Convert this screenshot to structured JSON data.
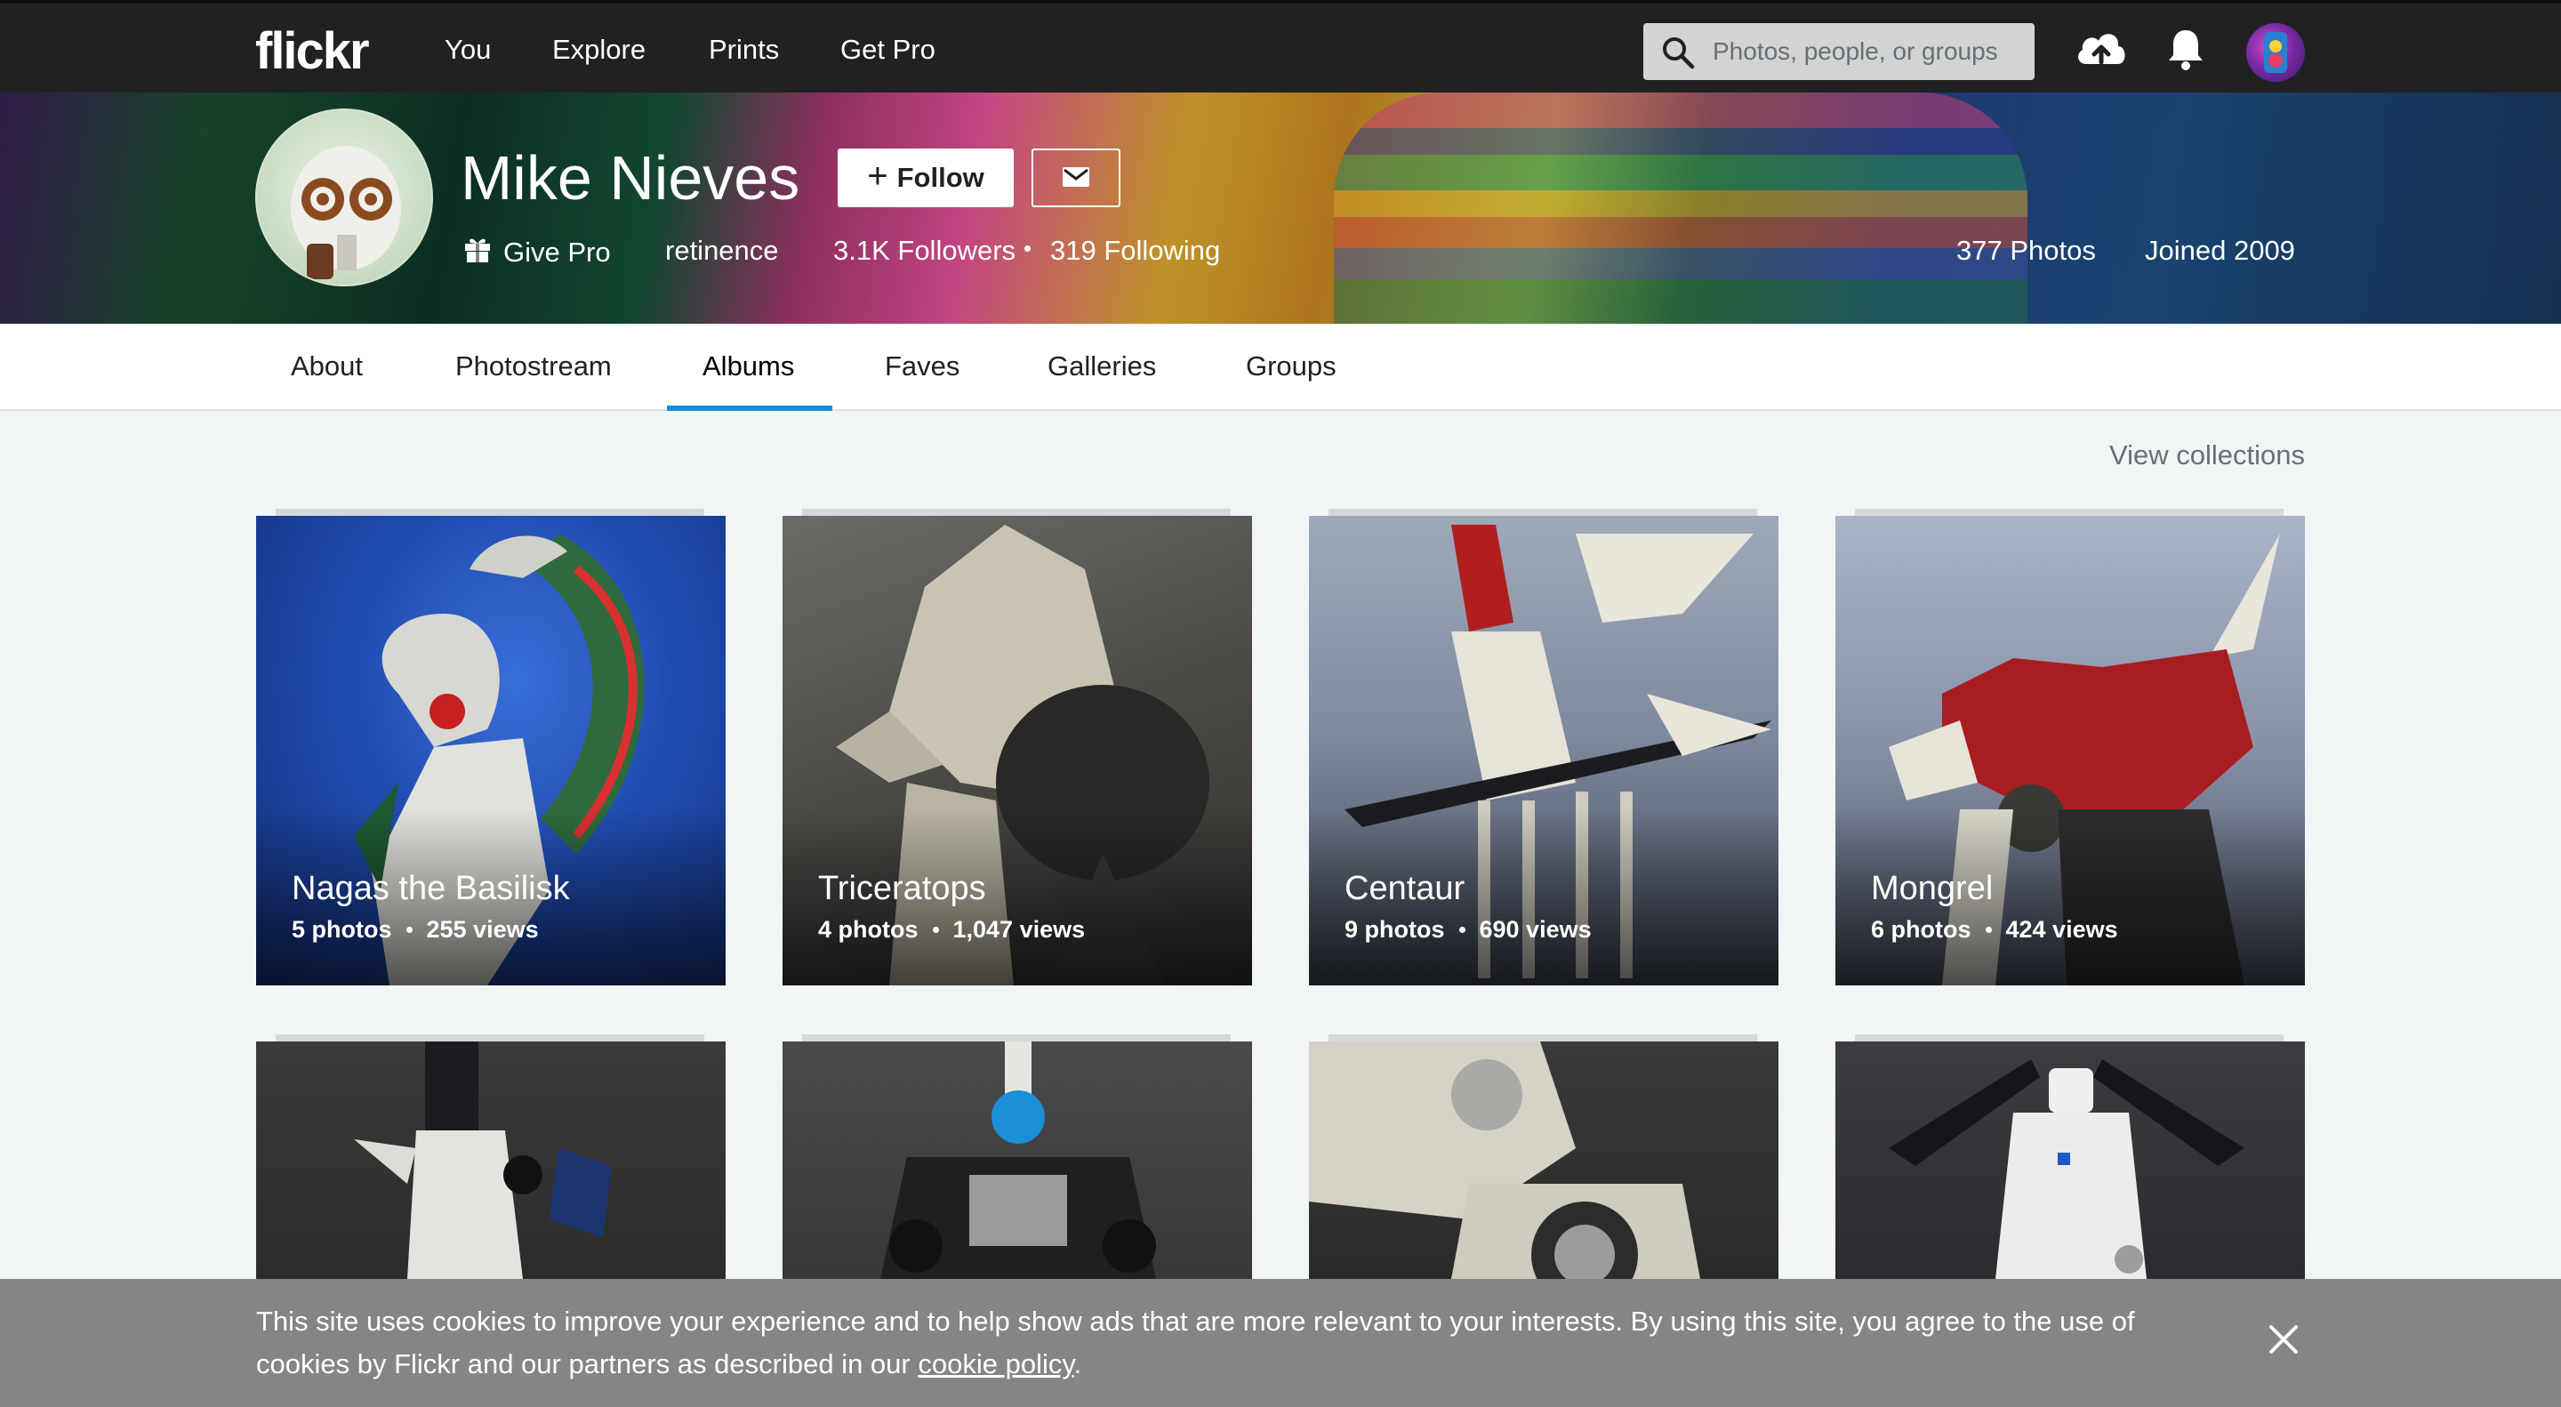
{
  "topnav": {
    "logo": "flickr",
    "links": [
      "You",
      "Explore",
      "Prints",
      "Get Pro"
    ],
    "search_placeholder": "Photos, people, or groups"
  },
  "profile": {
    "name": "Mike Nieves",
    "follow_label": "Follow",
    "give_pro_label": "Give Pro",
    "username": "retinence",
    "followers": "3.1K Followers",
    "following": "319 Following",
    "photos": "377 Photos",
    "joined": "Joined 2009"
  },
  "subnav": {
    "tabs": [
      "About",
      "Photostream",
      "Albums",
      "Faves",
      "Galleries",
      "Groups"
    ],
    "active": "Albums"
  },
  "view_collections": "View collections",
  "albums": [
    {
      "title": "Nagas the Basilisk",
      "photos": "5 photos",
      "views": "255 views"
    },
    {
      "title": "Triceratops",
      "photos": "4 photos",
      "views": "1,047 views"
    },
    {
      "title": "Centaur",
      "photos": "9 photos",
      "views": "690 views"
    },
    {
      "title": "Mongrel",
      "photos": "6 photos",
      "views": "424 views"
    }
  ],
  "cookie": {
    "text": "This site uses cookies to improve your experience and to help show ads that are more relevant to your interests. By using this site, you agree to the use of cookies by Flickr and our partners as described in our",
    "link": "cookie policy",
    "end": "."
  },
  "colors": {
    "nav_bg": "#212124",
    "active_tab": "#128fdc",
    "page_bg": "#f2f5f6"
  }
}
